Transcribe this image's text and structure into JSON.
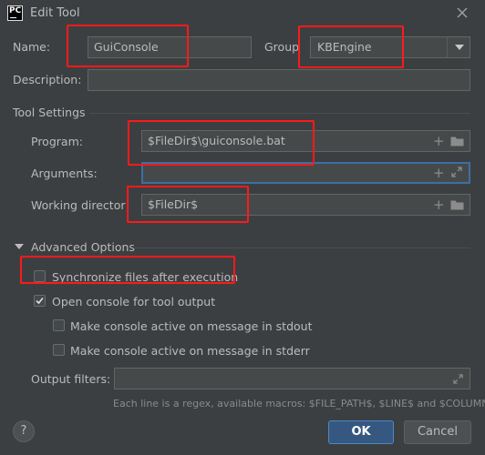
{
  "titlebar": {
    "app_badge": "PC",
    "title": "Edit Tool"
  },
  "form": {
    "name_label": "Name:",
    "name_value": "GuiConsole",
    "group_label": "Group",
    "group_value": "KBEngine",
    "description_label": "Description:",
    "description_value": ""
  },
  "tool_settings": {
    "header": "Tool Settings",
    "program_label": "Program:",
    "program_value": "$FileDir$\\guiconsole.bat",
    "arguments_label": "Arguments:",
    "arguments_value": "",
    "working_dir_label": "Working director",
    "working_dir_value": "$FileDir$"
  },
  "advanced": {
    "header": "Advanced Options",
    "sync_files_label": "Synchronize files after execution",
    "open_console_label": "Open console for tool output",
    "active_stdout_label": "Make console active on message in stdout",
    "active_stderr_label": "Make console active on message in stderr",
    "output_filters_label": "Output filters:",
    "output_filters_value": "",
    "hint": "Each line is a regex, available macros: $FILE_PATH$, $LINE$ and $COLUMN$"
  },
  "footer": {
    "help": "?",
    "ok_label": "OK",
    "cancel_label": "Cancel"
  },
  "colors": {
    "background": "#3c3f41",
    "field": "#45494a",
    "accent": "#4a88c7",
    "annotation": "#ff1a1a"
  }
}
